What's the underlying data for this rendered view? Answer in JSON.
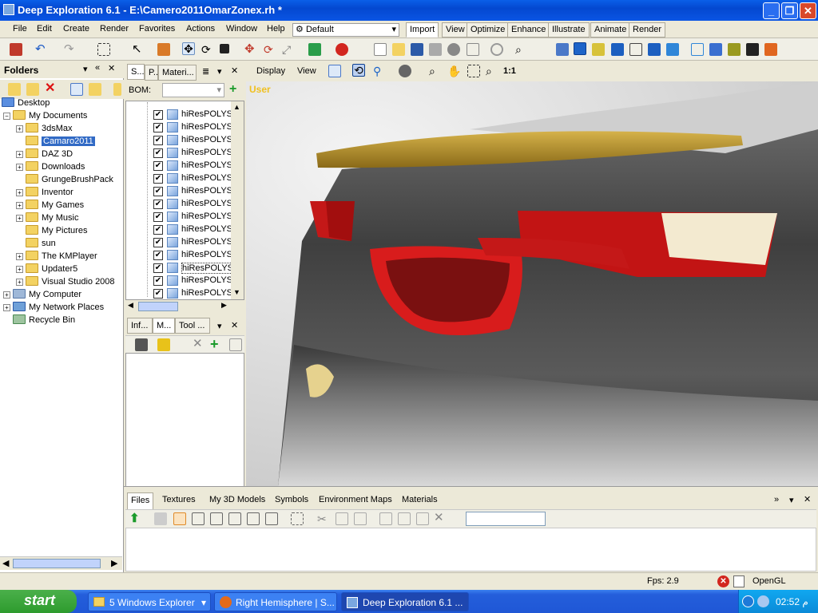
{
  "window": {
    "title": "Deep Exploration 6.1 - E:\\Camero2011OmarZonex.rh *"
  },
  "menu": [
    "File",
    "Edit",
    "Create",
    "Render",
    "Favorites",
    "Actions",
    "Window",
    "Help"
  ],
  "menu_default": "Default",
  "ribbon_tabs": [
    "Import",
    "View",
    "Optimize",
    "Enhance",
    "Illustrate",
    "Animate",
    "Render"
  ],
  "folders": {
    "title": "Folders",
    "tree": [
      {
        "label": "Desktop",
        "level": 0
      },
      {
        "label": "My Documents",
        "level": 1
      },
      {
        "label": "3dsMax",
        "level": 2
      },
      {
        "label": "Camaro2011",
        "level": 2,
        "selected": true
      },
      {
        "label": "DAZ 3D",
        "level": 2
      },
      {
        "label": "Downloads",
        "level": 2
      },
      {
        "label": "GrungeBrushPack",
        "level": 2
      },
      {
        "label": "Inventor",
        "level": 2
      },
      {
        "label": "My Games",
        "level": 2
      },
      {
        "label": "My Music",
        "level": 2
      },
      {
        "label": "My Pictures",
        "level": 2
      },
      {
        "label": "sun",
        "level": 2
      },
      {
        "label": "The KMPlayer",
        "level": 2
      },
      {
        "label": "Updater5",
        "level": 2
      },
      {
        "label": "Visual Studio 2008",
        "level": 2
      },
      {
        "label": "My Computer",
        "level": 1
      },
      {
        "label": "My Network Places",
        "level": 1
      },
      {
        "label": "Recycle Bin",
        "level": 1
      }
    ]
  },
  "scene_tabs": [
    "S...",
    "P...",
    "Materi..."
  ],
  "bom_label": "BOM:",
  "bom_items": [
    "hiResPOLYS_",
    "hiResPOLYS_",
    "hiResPOLYS_",
    "hiResPOLYS_",
    "hiResPOLYS_",
    "hiResPOLYS_",
    "hiResPOLYS_",
    "hiResPOLYS_",
    "hiResPOLYS_",
    "hiResPOLYS_",
    "hiResPOLYS_",
    "hiResPOLYS_",
    "hiResPOLYS_",
    "hiResPOLYS_",
    "hiResPOLYS_"
  ],
  "info_tabs": [
    "Inf...",
    "M...",
    "Tool ..."
  ],
  "view_toolbar": {
    "display": "Display",
    "view": "View",
    "ratio": "1:1"
  },
  "viewport_label": "User",
  "bottom_tabs": [
    "Files",
    "Textures",
    "My 3D Models",
    "Symbols",
    "Environment Maps",
    "Materials"
  ],
  "status": {
    "fps": "Fps:  2.9",
    "renderer": "OpenGL"
  },
  "taskbar": {
    "start": "start",
    "tasks": [
      "5 Windows Explorer",
      "Right Hemisphere | S...",
      "Deep Exploration 6.1 ..."
    ],
    "clock": "02:52 م"
  }
}
